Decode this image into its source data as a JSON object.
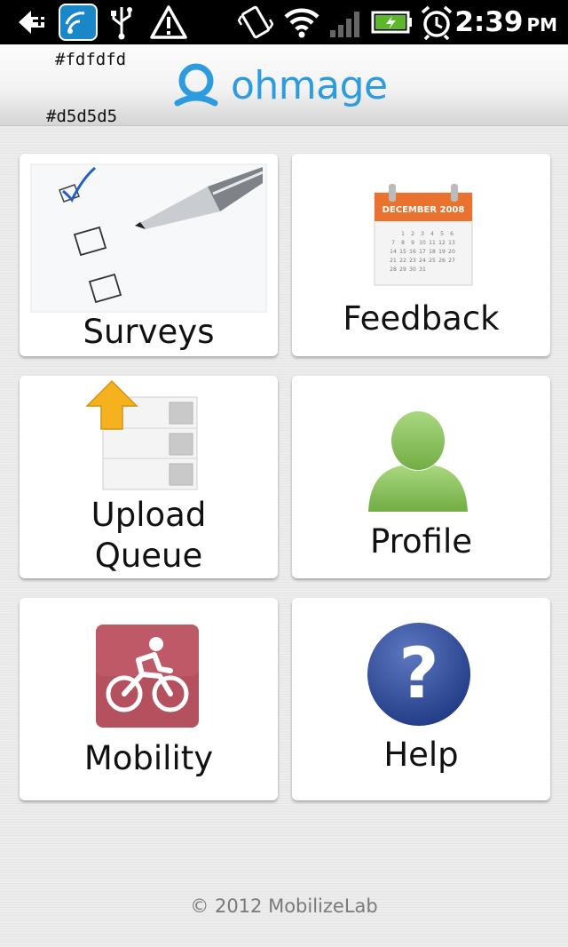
{
  "status_bar": {
    "time": "2:39",
    "ampm": "PM",
    "icons": [
      "back-notification-icon",
      "wifi-app-icon",
      "usb-icon",
      "warning-icon",
      "vibrate-icon",
      "wifi-signal-icon",
      "cell-signal-icon",
      "battery-icon",
      "alarm-icon"
    ]
  },
  "header": {
    "app_name": "ohmage",
    "swatch_top": "#fdfdfd",
    "swatch_bottom": "#d5d5d5"
  },
  "tiles": [
    {
      "label": "Surveys",
      "icon": "checklist-icon"
    },
    {
      "label": "Feedback",
      "icon": "calendar-icon",
      "calendar_title": "DECEMBER 2008"
    },
    {
      "label_line1": "Upload",
      "label_line2": "Queue",
      "icon": "upload-queue-icon"
    },
    {
      "label": "Profile",
      "icon": "person-icon"
    },
    {
      "label": "Mobility",
      "icon": "bicycle-icon"
    },
    {
      "label": "Help",
      "icon": "question-icon"
    }
  ],
  "footer": "© 2012 MobilizeLab",
  "colors": {
    "brand": "#2d9be0",
    "calendar_header": "#e8722e",
    "profile_green": "#8cc35a",
    "mobility_red": "#b5505f",
    "help_blue": "#2c4a94"
  }
}
